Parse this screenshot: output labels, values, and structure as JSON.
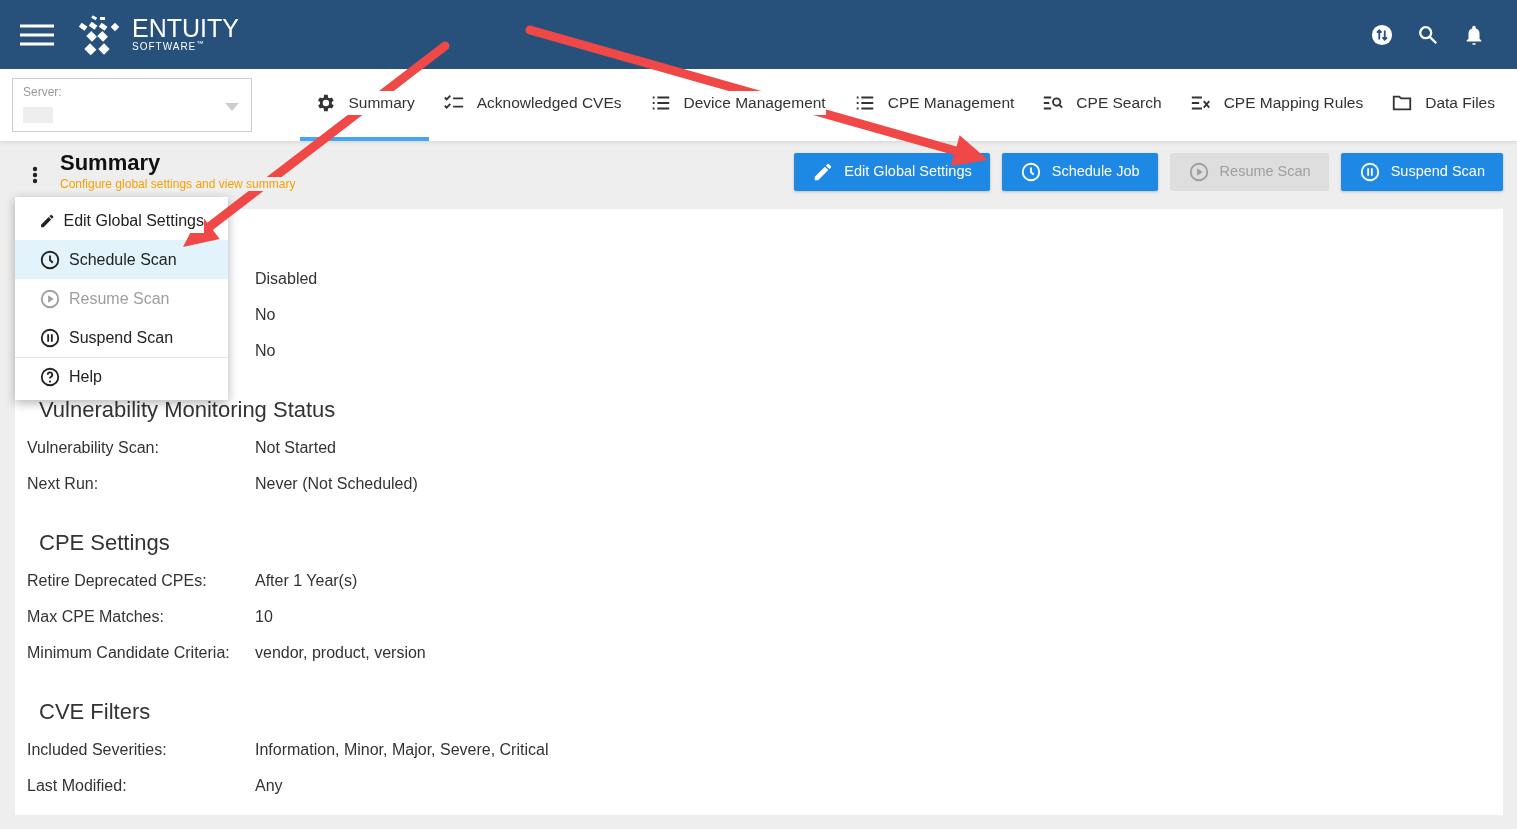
{
  "header": {
    "brand": "ENTUITY",
    "brand_sub": "SOFTWARE$^{™}$"
  },
  "server": {
    "label": "Server:"
  },
  "tabs": [
    {
      "label": "Summary",
      "selected": true
    },
    {
      "label": "Acknowledged CVEs",
      "selected": false
    },
    {
      "label": "Device Management",
      "selected": false
    },
    {
      "label": "CPE Management",
      "selected": false
    },
    {
      "label": "CPE Search",
      "selected": false
    },
    {
      "label": "CPE Mapping Rules",
      "selected": false
    },
    {
      "label": "Data Files",
      "selected": false
    }
  ],
  "page": {
    "title": "Summary",
    "subtitle": "Configure global settings and view summary"
  },
  "actions": [
    {
      "label": "Edit Global Settings",
      "disabled": false
    },
    {
      "label": "Schedule Job",
      "disabled": false
    },
    {
      "label": "Resume Scan",
      "disabled": true
    },
    {
      "label": "Suspend Scan",
      "disabled": false
    }
  ],
  "menu": [
    {
      "label": "Edit Global Settings",
      "selected": false,
      "disabled": false,
      "divider_before": false
    },
    {
      "label": "Schedule Scan",
      "selected": true,
      "disabled": false,
      "divider_before": false
    },
    {
      "label": "Resume Scan",
      "selected": false,
      "disabled": true,
      "divider_before": false
    },
    {
      "label": "Suspend Scan",
      "selected": false,
      "disabled": false,
      "divider_before": false
    },
    {
      "label": "Help",
      "selected": false,
      "disabled": false,
      "divider_before": true
    }
  ],
  "sections": [
    {
      "rows": [
        {
          "value": "Disabled"
        },
        {
          "value": "No"
        },
        {
          "value": "No"
        }
      ]
    },
    {
      "heading": "Vulnerability Monitoring Status",
      "rows": [
        {
          "label": "Vulnerability Scan:",
          "value": "Not Started"
        },
        {
          "label": "Next Run:",
          "value": "Never (Not Scheduled)"
        }
      ]
    },
    {
      "heading": "CPE Settings",
      "rows": [
        {
          "label": "Retire Deprecated CPEs:",
          "value": "After 1 Year(s)"
        },
        {
          "label": "Max CPE Matches:",
          "value": "10"
        },
        {
          "label": "Minimum Candidate Criteria:",
          "value": "vendor, product, version"
        }
      ]
    },
    {
      "heading": "CVE Filters",
      "rows": [
        {
          "label": "Included Severities:",
          "value": "Information, Minor, Major, Severe, Critical"
        },
        {
          "label": "Last Modified:",
          "value": "Any"
        }
      ]
    }
  ]
}
